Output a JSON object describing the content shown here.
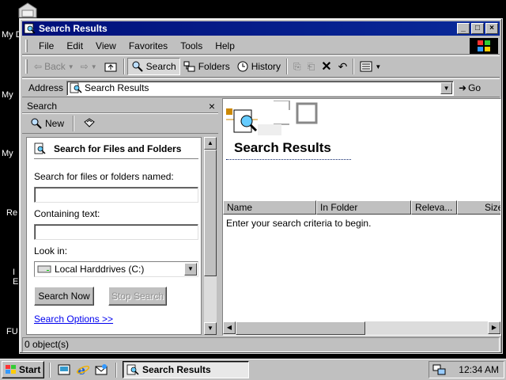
{
  "desktop": {
    "labels": [
      "My D",
      "My",
      "My",
      "Re",
      "I",
      "E",
      "FU"
    ]
  },
  "window": {
    "title": "Search Results",
    "menu": [
      "File",
      "Edit",
      "View",
      "Favorites",
      "Tools",
      "Help"
    ],
    "toolbar": {
      "back": "Back",
      "search": "Search",
      "folders": "Folders",
      "history": "History"
    },
    "address": {
      "label": "Address",
      "value": "Search Results",
      "go": "Go"
    },
    "search_pane": {
      "title": "Search",
      "new_label": "New",
      "heading": "Search for Files and Folders",
      "named_label": "Search for files or folders named:",
      "named_value": "",
      "containing_label": "Containing text:",
      "containing_value": "",
      "lookin_label": "Look in:",
      "lookin_value": "Local Harddrives (C:)",
      "search_now": "Search Now",
      "stop_search": "Stop Search",
      "options_link": "Search Options >>"
    },
    "results": {
      "title": "Search Results",
      "columns": [
        "Name",
        "In Folder",
        "Releva...",
        "Size"
      ],
      "empty_message": "Enter your search criteria to begin."
    },
    "status": "0 object(s)"
  },
  "taskbar": {
    "start": "Start",
    "task": "Search Results",
    "clock": "12:34 AM"
  },
  "colors": {
    "titlebar": "#0a1a8c",
    "face": "#c0c0c0",
    "link": "#0000ee"
  }
}
